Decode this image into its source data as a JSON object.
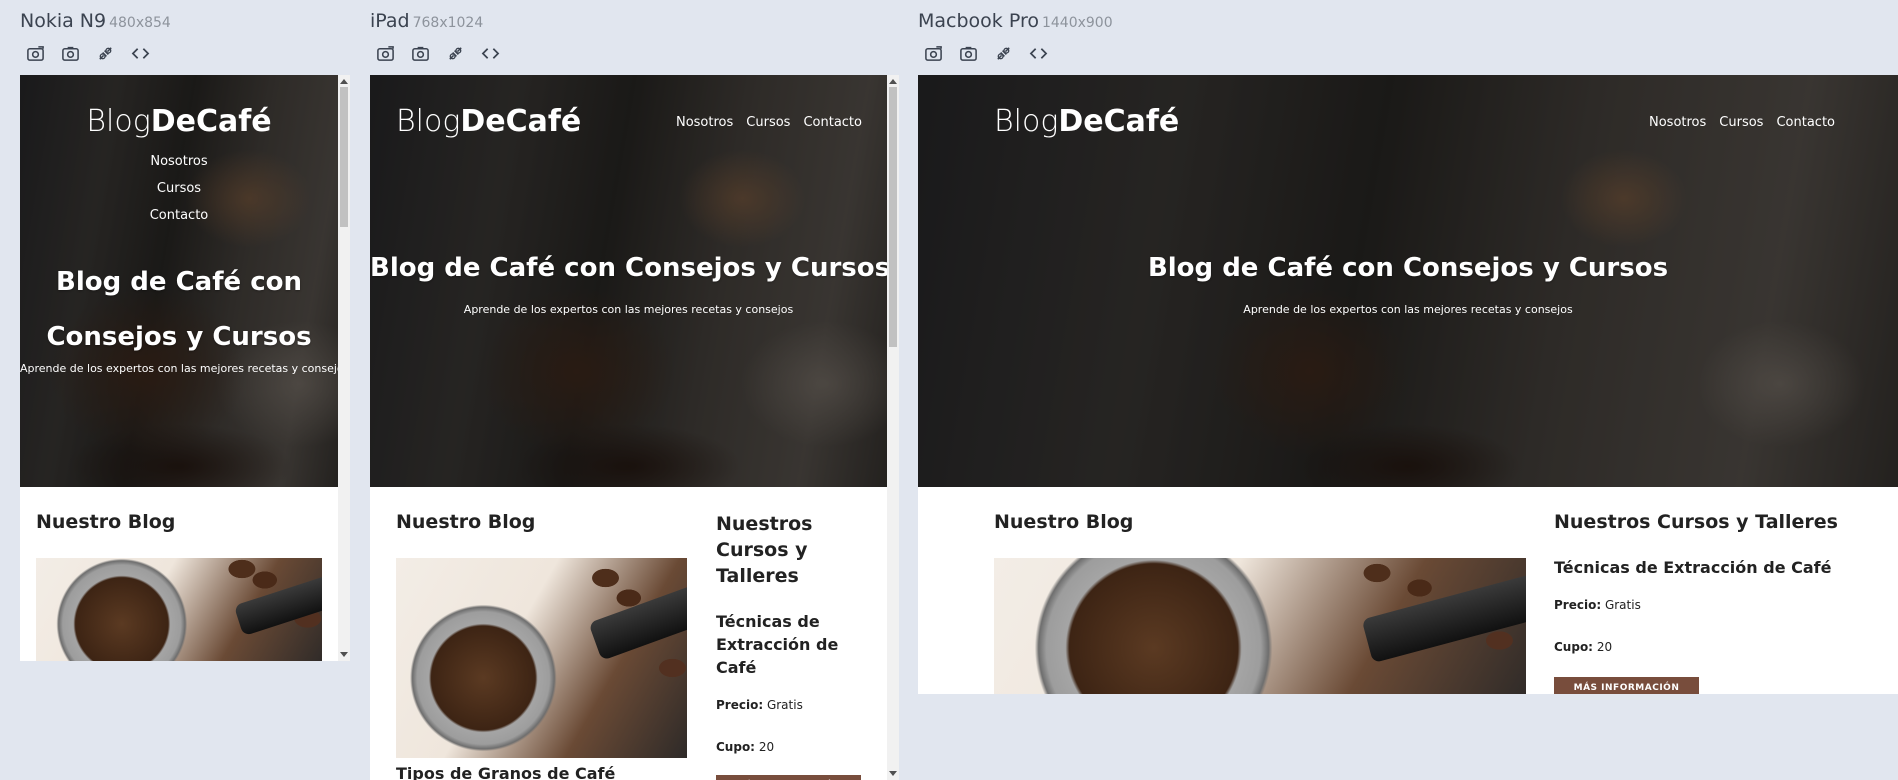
{
  "devices": [
    {
      "name": "Nokia N9",
      "size": "480x854"
    },
    {
      "name": "iPad",
      "size": "768x1024"
    },
    {
      "name": "Macbook Pro",
      "size": "1440x900"
    }
  ],
  "toolbar": {
    "icons": [
      "camera-settings-icon",
      "camera-icon",
      "connect-plug-icon",
      "code-icon"
    ]
  },
  "site": {
    "logo_thin": "Blog",
    "logo_bold": "DeCafé",
    "nav": [
      "Nosotros",
      "Cursos",
      "Contacto"
    ],
    "hero_title": "Blog de Café con Consejos y Cursos",
    "hero_subtitle": "Aprende de los expertos con las mejores recetas y consejos",
    "blog_title": "Nuestro Blog",
    "courses_title": "Nuestros Cursos y Talleres",
    "course_name": "Técnicas de Extracción de Café",
    "price_label": "Precio:",
    "price_value": "Gratis",
    "cupo_label": "Cupo:",
    "cupo_value": "20",
    "course_button": "Más Información",
    "post_title": "Tipos de Granos de Café"
  },
  "colors": {
    "page_bg": "#e1e6ef",
    "button_bg": "#784d3c"
  }
}
